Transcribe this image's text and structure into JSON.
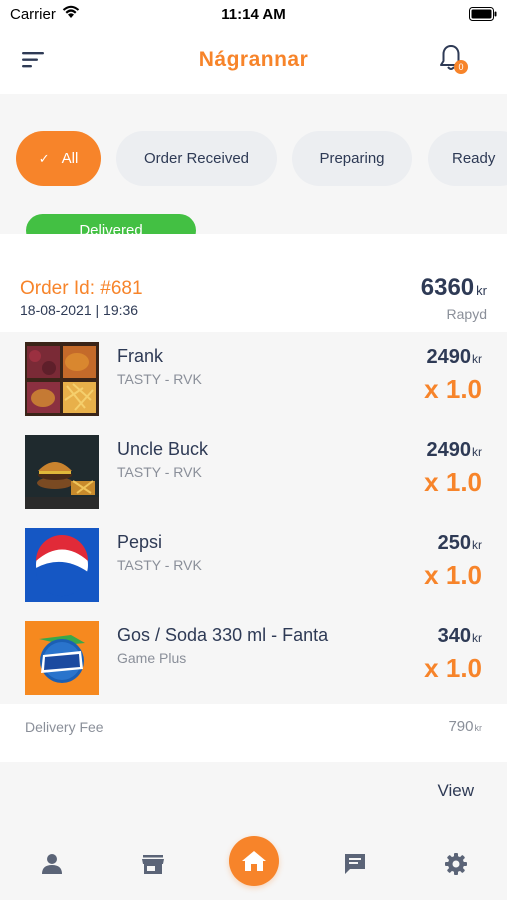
{
  "status_bar": {
    "carrier": "Carrier",
    "time": "11:14 AM"
  },
  "header": {
    "title": "Nágrannar",
    "notification_count": "0"
  },
  "filters": {
    "chips": [
      {
        "label": "All",
        "active": true
      },
      {
        "label": "Order Received",
        "active": false
      },
      {
        "label": "Preparing",
        "active": false
      },
      {
        "label": "Ready",
        "active": false
      }
    ],
    "delivered_label": "Delivered"
  },
  "order": {
    "id_label": "Order Id: #681",
    "datetime": "18-08-2021 | 19:36",
    "total": "6360",
    "currency": "kr",
    "payment_method": "Rapyd",
    "items": [
      {
        "name": "Frank",
        "store": "TASTY - RVK",
        "price": "2490",
        "currency": "kr",
        "qty": "x 1.0",
        "thumb": "fries-wings-box"
      },
      {
        "name": "Uncle Buck",
        "store": "TASTY - RVK",
        "price": "2490",
        "currency": "kr",
        "qty": "x 1.0",
        "thumb": "burger-fries"
      },
      {
        "name": "Pepsi",
        "store": "TASTY - RVK",
        "price": "250",
        "currency": "kr",
        "qty": "x 1.0",
        "thumb": "pepsi-logo"
      },
      {
        "name": "Gos / Soda 330 ml - Fanta",
        "store": "Game Plus",
        "price": "340",
        "currency": "kr",
        "qty": "x 1.0",
        "thumb": "fanta-logo"
      }
    ],
    "delivery_fee_label": "Delivery Fee",
    "delivery_fee": "790",
    "delivery_fee_currency": "kr"
  },
  "view_label": "View",
  "tabbar": {
    "icons": [
      "user-icon",
      "store-icon",
      "home-icon",
      "chat-icon",
      "gear-icon"
    ]
  },
  "colors": {
    "accent": "#f7842a",
    "success": "#43c043",
    "text": "#2e3a55",
    "muted": "#8a8f99"
  }
}
